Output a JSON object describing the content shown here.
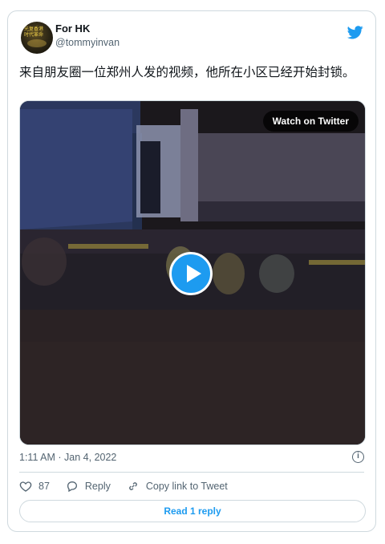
{
  "author": {
    "name": "For HK",
    "handle": "@tommyinvan",
    "avatar_icon": "avatar-image"
  },
  "tweet": {
    "text": "来自朋友圈一位郑州人发的视频，他所在小区已经开始封锁。"
  },
  "media": {
    "watch_label": "Watch on Twitter",
    "play_icon": "play-icon"
  },
  "meta": {
    "timestamp": "1:11 AM · Jan 4, 2022",
    "info_icon": "info-icon"
  },
  "actions": {
    "like_count": "87",
    "reply_label": "Reply",
    "copy_label": "Copy link to Tweet"
  },
  "footer": {
    "read_label": "Read 1 reply"
  },
  "colors": {
    "accent": "#1d9bf0",
    "muted": "#536471",
    "border": "#cfd9de"
  }
}
